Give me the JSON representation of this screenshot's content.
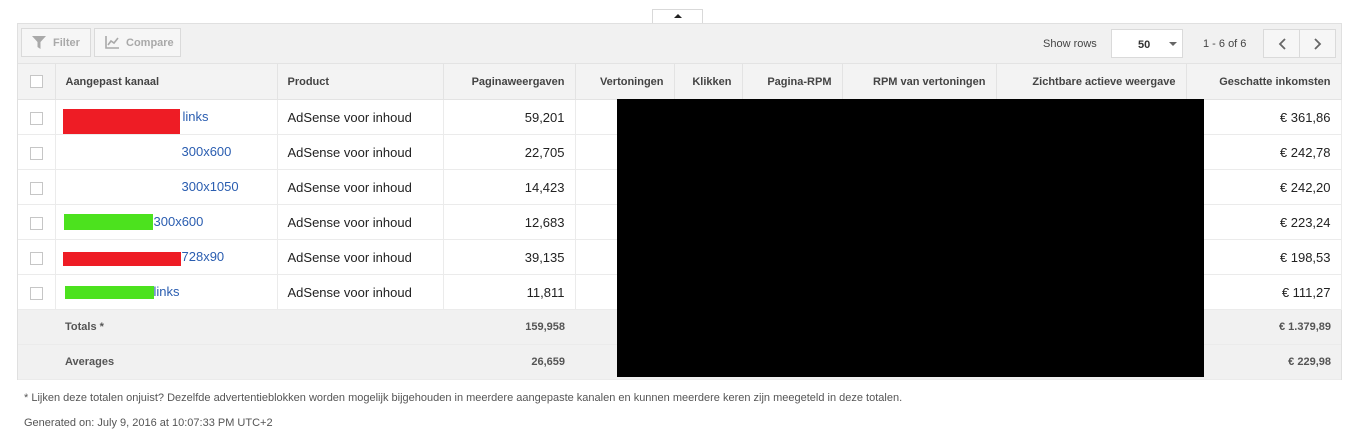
{
  "toolbar": {
    "filter_label": "Filter",
    "compare_label": "Compare",
    "show_rows_label": "Show rows",
    "rows_value": "50",
    "page_range": "1 - 6 of 6"
  },
  "columns": {
    "channel": "Aangepast kanaal",
    "product": "Product",
    "pageviews": "Paginaweergaven",
    "impressions": "Vertoningen",
    "clicks": "Klikken",
    "page_rpm": "Pagina-RPM",
    "impression_rpm": "RPM van vertoningen",
    "active_view": "Zichtbare actieve weergave",
    "earnings": "Geschatte inkomsten"
  },
  "rows": [
    {
      "channel": "links",
      "product": "AdSense voor inhoud",
      "pageviews": "59,201",
      "earnings": "€ 361,86"
    },
    {
      "channel": "300x600",
      "product": "AdSense voor inhoud",
      "pageviews": "22,705",
      "earnings": "€ 242,78"
    },
    {
      "channel": "300x1050",
      "product": "AdSense voor inhoud",
      "pageviews": "14,423",
      "earnings": "€ 242,20"
    },
    {
      "channel": "300x600",
      "product": "AdSense voor inhoud",
      "pageviews": "12,683",
      "earnings": "€ 223,24"
    },
    {
      "channel": "728x90",
      "product": "AdSense voor inhoud",
      "pageviews": "39,135",
      "earnings": "€ 198,53"
    },
    {
      "channel": "links",
      "product": "AdSense voor inhoud",
      "pageviews": "11,811",
      "earnings": "€ 111,27"
    }
  ],
  "totals": {
    "label": "Totals *",
    "pageviews": "159,958",
    "earnings": "€ 1.379,89"
  },
  "averages": {
    "label": "Averages",
    "pageviews": "26,659",
    "earnings": "€ 229,98"
  },
  "footnote": "* Lijken deze totalen onjuist? Dezelfde advertentieblokken worden mogelijk bijgehouden in meerdere aangepaste kanalen en kunnen meerdere keren zijn meegeteld in deze totalen.",
  "generated": "Generated on: July 9, 2016 at 10:07:33 PM UTC+2",
  "colors": {
    "redaction_red": "#ee1c25",
    "redaction_green": "#4ce21e",
    "redaction_black": "#000000",
    "link": "#2a5db0"
  }
}
